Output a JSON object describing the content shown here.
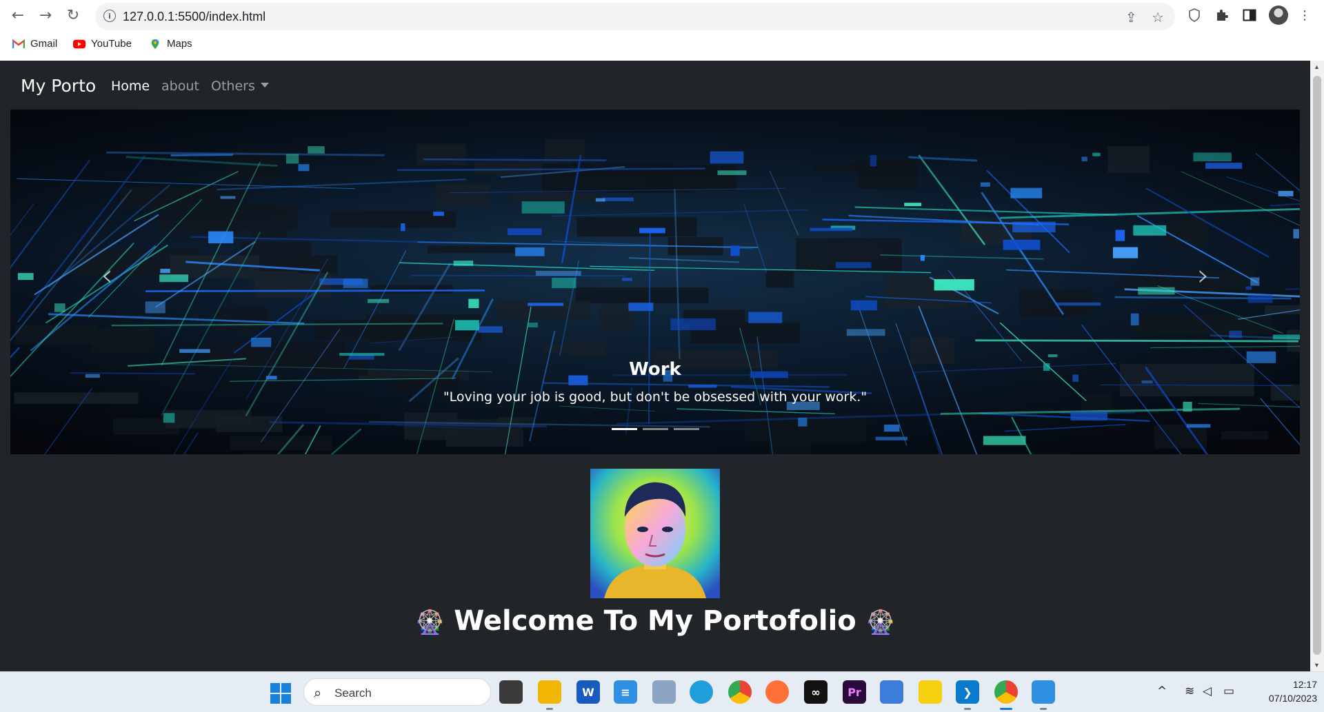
{
  "browser": {
    "url": "127.0.0.1:5500/index.html",
    "bookmarks": [
      {
        "label": "Gmail",
        "icon": "gmail-icon"
      },
      {
        "label": "YouTube",
        "icon": "youtube-icon"
      },
      {
        "label": "Maps",
        "icon": "maps-icon"
      }
    ]
  },
  "navbar": {
    "brand": "My Porto",
    "links": [
      {
        "label": "Home",
        "active": true
      },
      {
        "label": "about",
        "active": false
      },
      {
        "label": "Others",
        "active": false,
        "dropdown": true
      }
    ]
  },
  "carousel": {
    "caption_title": "Work",
    "caption_text": "\"Loving your job is good, but don't be obsessed with your work.\"",
    "indicator_count": 3,
    "active_index": 0,
    "prev_icon": "chevron-left-icon",
    "next_icon": "chevron-right-icon"
  },
  "main": {
    "welcome_text": "Welcome To My Portofolio",
    "welcome_emoji": "🎡"
  },
  "taskbar": {
    "search_label": "Search",
    "time": "12:17",
    "date": "07/10/2023"
  },
  "colors": {
    "page_bg": "#212529",
    "brand_text": "#ffffff",
    "accent_blue": "#1a73e8"
  }
}
